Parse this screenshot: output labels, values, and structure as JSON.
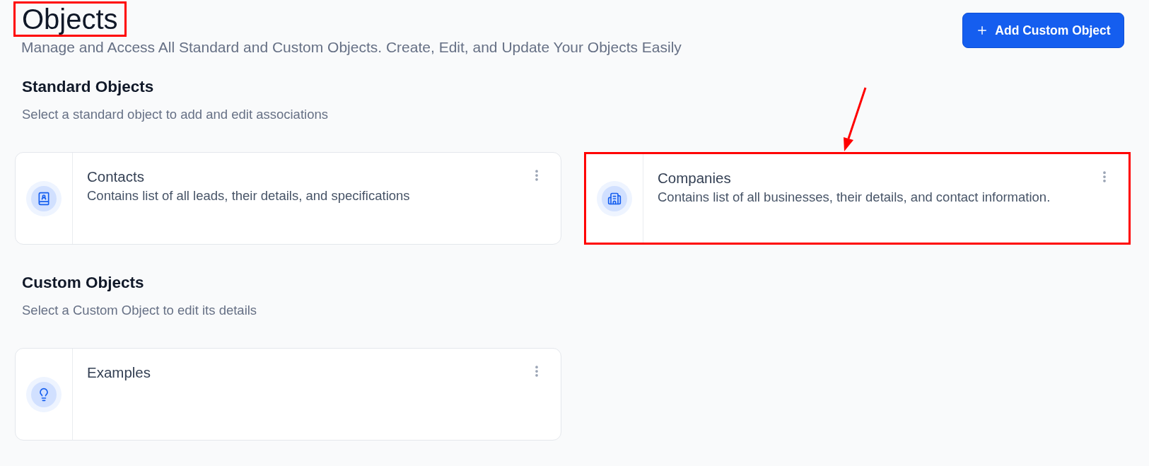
{
  "header": {
    "title": "Objects",
    "title_highlighted": true,
    "subtitle": "Manage and Access All Standard and Custom Objects. Create, Edit, and Update Your Objects Easily",
    "action_button": {
      "label": "Add Custom Object"
    }
  },
  "sections": [
    {
      "title": "Standard Objects",
      "subtitle": "Select a standard object to add and edit associations",
      "cards": [
        {
          "kind": "contacts",
          "title": "Contacts",
          "description": "Contains list of all leads, their details, and specifications",
          "highlighted": false
        },
        {
          "kind": "buildings",
          "title": "Companies",
          "description": "Contains list of all businesses, their details, and contact information.",
          "highlighted": true
        }
      ]
    },
    {
      "title": "Custom Objects",
      "subtitle": "Select a Custom Object to edit its details",
      "cards": [
        {
          "kind": "lightbulb",
          "title": "Examples",
          "highlighted": false
        }
      ]
    }
  ]
}
